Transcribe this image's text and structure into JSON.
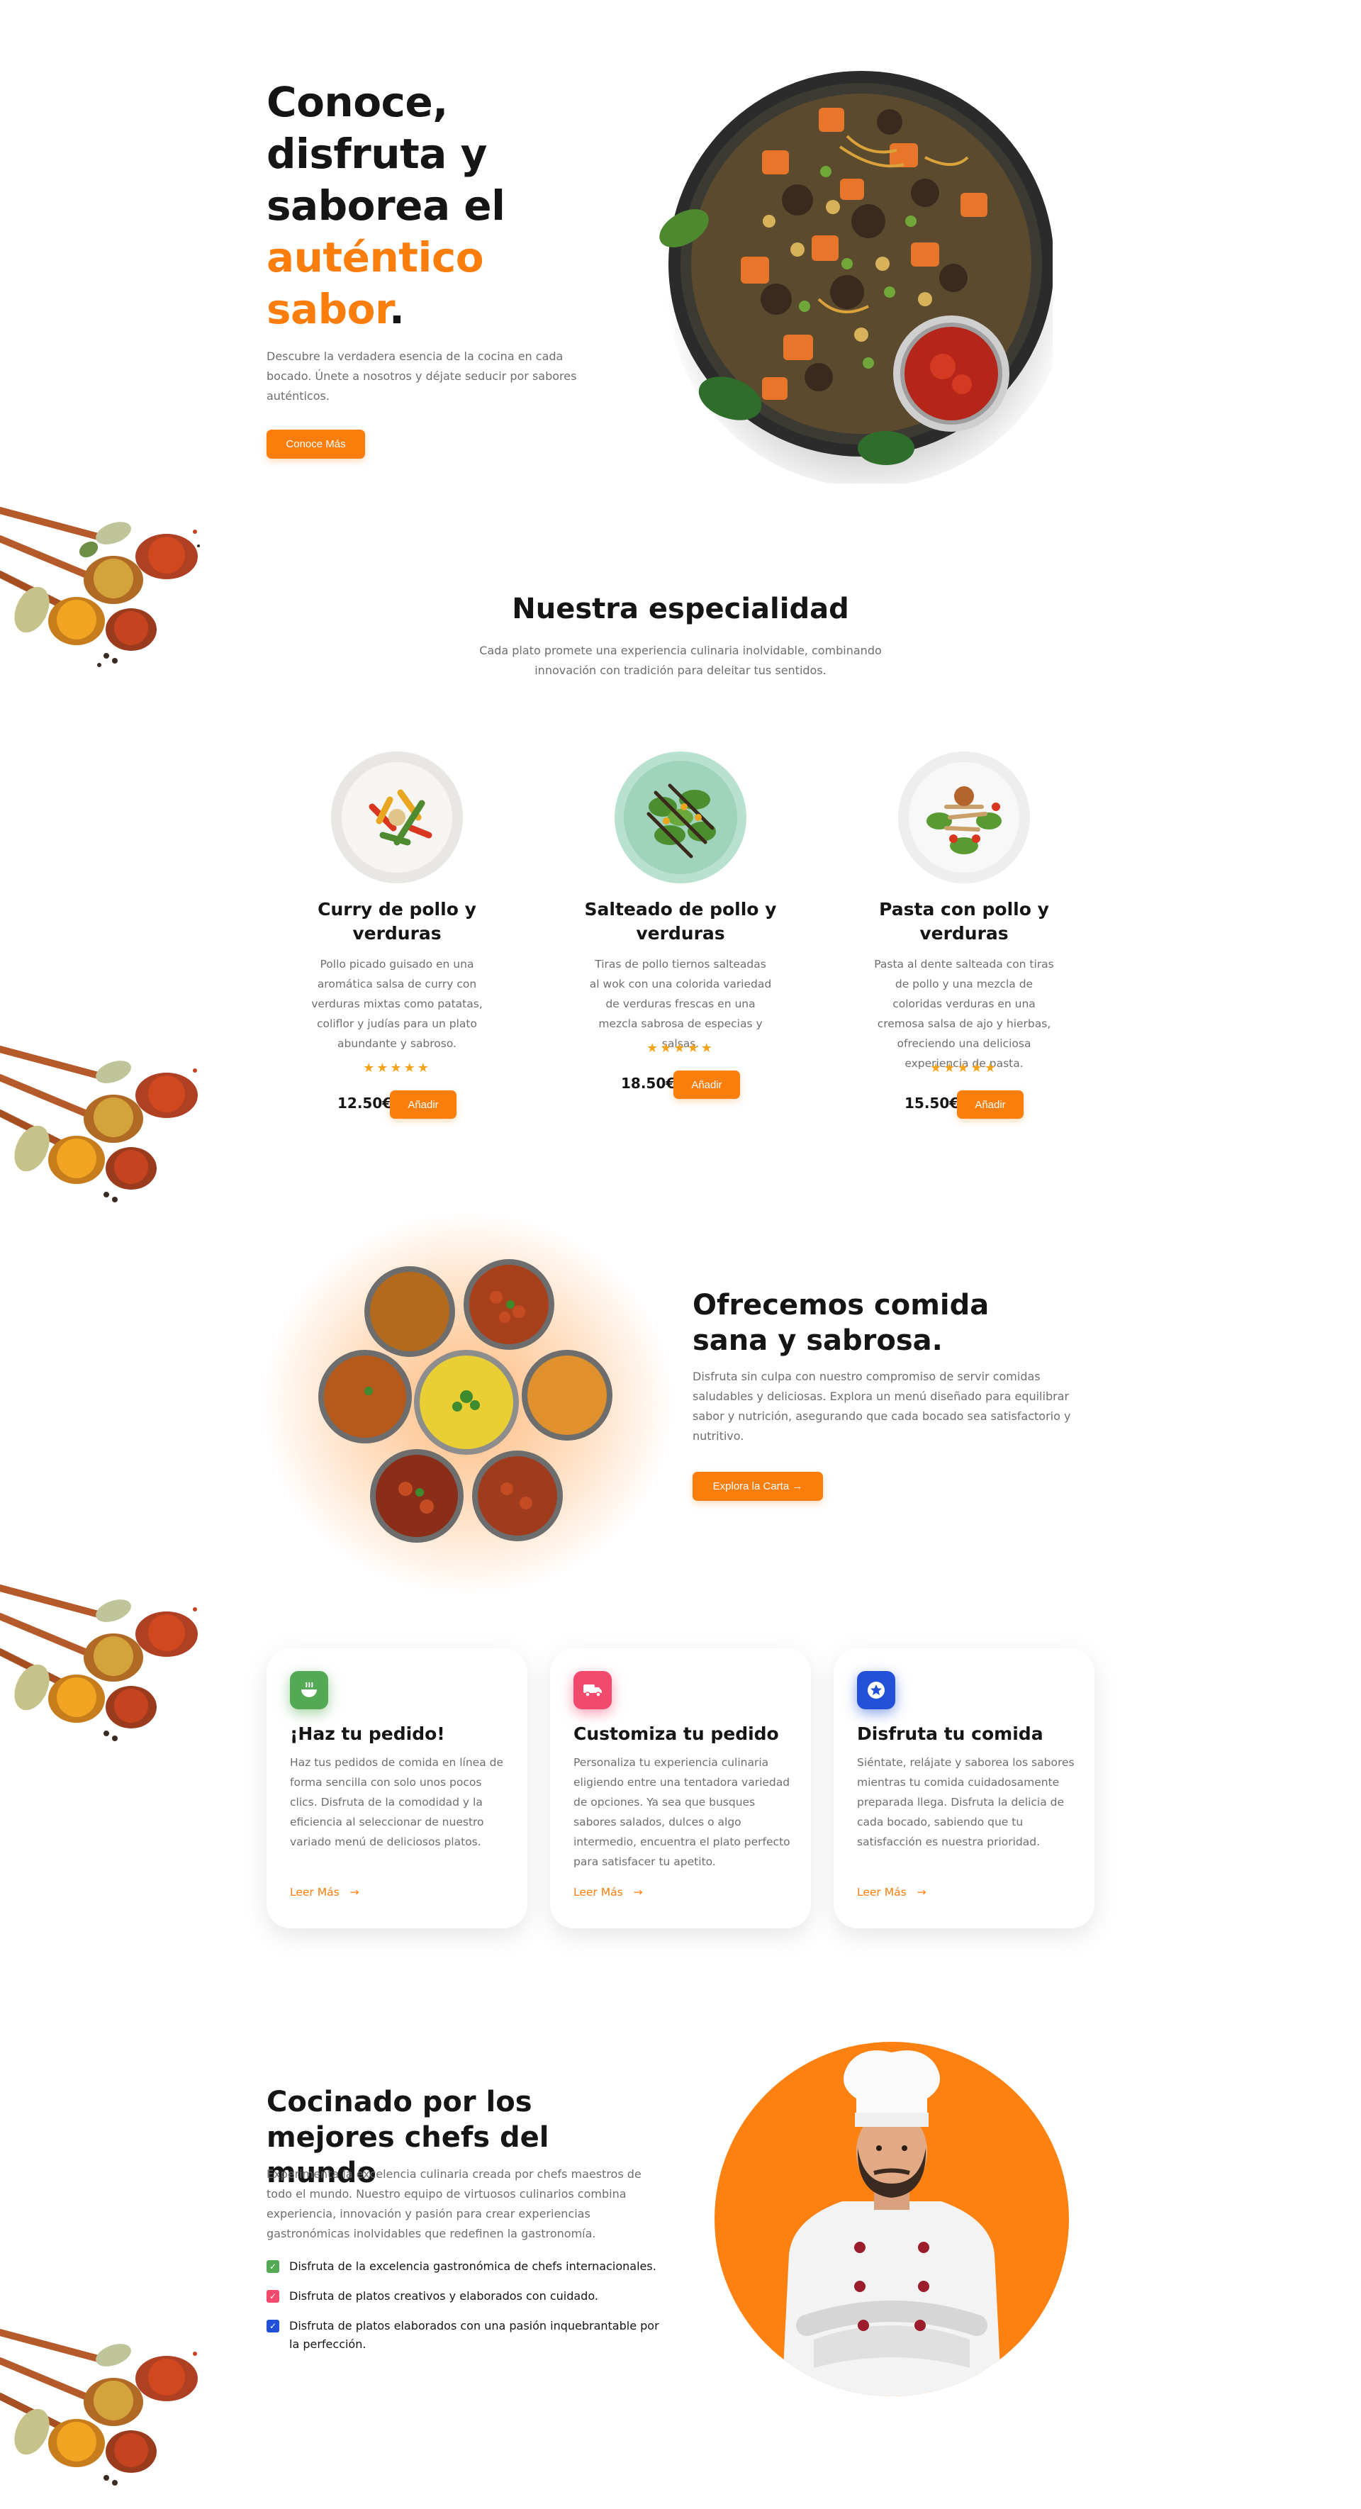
{
  "colors": {
    "accent": "#fb7d0c",
    "text": "#151515",
    "muted": "#6e6e6e",
    "star": "#f3a31c",
    "green": "#53a954",
    "pink": "#f24a6c",
    "blue": "#2251d8"
  },
  "hero": {
    "title_line1": "Conoce,",
    "title_line2": "disfruta y",
    "title_line3": "saborea el",
    "title_accent1": "auténtico",
    "title_accent2": "sabor",
    "title_dot": ".",
    "description": "Descubre la verdadera esencia de la cocina en cada bocado. Únete a nosotros y déjate seducir por sabores auténticos.",
    "button": "Conoce Más"
  },
  "specialty": {
    "title": "Nuestra especialidad",
    "subtitle": "Cada plato promete una experiencia culinaria inolvidable, combinando innovación con tradición para deleitar tus sentidos.",
    "dishes": [
      {
        "name": "Curry de pollo y verduras",
        "description": "Pollo picado guisado en una aromática salsa de curry con verduras mixtas como patatas, coliflor y judías para un plato abundante y sabroso.",
        "stars": "★★★★★",
        "rating": 5,
        "price": "12.50€",
        "button": "Añadir"
      },
      {
        "name": "Salteado de pollo y verduras",
        "description": "Tiras de pollo tiernos salteadas al wok con una colorida variedad de verduras frescas en una mezcla sabrosa de especias y salsas.",
        "stars": "★★★★★",
        "rating": 5,
        "price": "18.50€",
        "button": "Añadir"
      },
      {
        "name": "Pasta con pollo y verduras",
        "description": "Pasta al dente salteada con tiras de pollo y una mezcla de coloridas verduras en una cremosa salsa de ajo y hierbas, ofreciendo una deliciosa experiencia de pasta.",
        "stars": "★★★★★",
        "rating": 5,
        "price": "15.50€",
        "button": "Añadir"
      }
    ]
  },
  "healthy": {
    "title": "Ofrecemos comida sana y sabrosa.",
    "description": "Disfruta sin culpa con nuestro compromiso de servir comidas saludables y deliciosas. Explora un menú diseñado para equilibrar sabor y nutrición, asegurando que cada bocado sea satisfactorio y nutritivo.",
    "button": "Explora la Carta →"
  },
  "steps": [
    {
      "icon": "bowl-icon",
      "title": "¡Haz tu pedido!",
      "description": "Haz tus pedidos de comida en línea de forma sencilla con solo unos pocos clics. Disfruta de la comodidad y la eficiencia al seleccionar de nuestro variado menú de deliciosos platos.",
      "link": "Leer Más",
      "arrow": "→"
    },
    {
      "icon": "truck-icon",
      "title": "Customiza tu pedido",
      "description": "Personaliza tu experiencia culinaria eligiendo entre una tentadora variedad de opciones. Ya sea que busques sabores salados, dulces o algo intermedio, encuentra el plato perfecto para satisfacer tu apetito.",
      "link": "Leer Más",
      "arrow": "→"
    },
    {
      "icon": "star-badge-icon",
      "title": "Disfruta tu comida",
      "description": "Siéntate, relájate y saborea los sabores mientras tu comida cuidadosamente preparada llega. Disfruta la delicia de cada bocado, sabiendo que tu satisfacción es nuestra prioridad.",
      "link": "Leer Más",
      "arrow": "→"
    }
  ],
  "chefs": {
    "title": "Cocinado por los mejores chefs del mundo",
    "description": "Experimenta la excelencia culinaria creada por chefs maestros de todo el mundo. Nuestro equipo de virtuosos culinarios combina experiencia, innovación y pasión para crear experiencias gastronómicas inolvidables que redefinen la gastronomía.",
    "checks": [
      {
        "text": "Disfruta de la excelencia gastronómica de chefs internacionales.",
        "mark": "✓"
      },
      {
        "text": "Disfruta de platos creativos y elaborados con cuidado.",
        "mark": "✓"
      },
      {
        "text": "Disfruta de platos elaborados con una pasión inquebrantable por la perfección.",
        "mark": "✓"
      }
    ]
  }
}
